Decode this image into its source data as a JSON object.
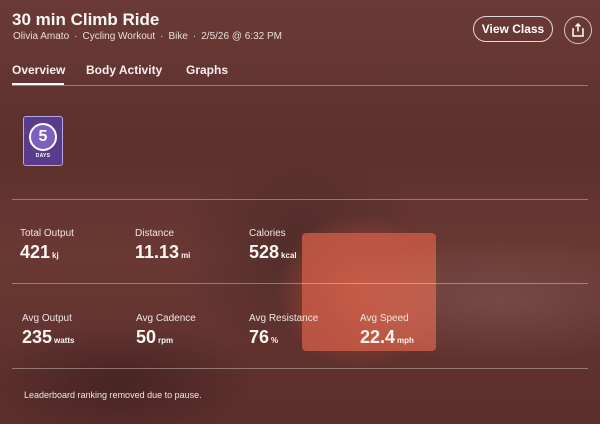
{
  "header": {
    "title": "30 min Climb Ride",
    "instructor": "Olivia Amato",
    "category": "Cycling Workout",
    "device": "Bike",
    "datetime": "2/5/26 @ 6:32 PM",
    "view_class_label": "View Class",
    "share_icon": "share-icon"
  },
  "tabs": [
    {
      "label": "Overview",
      "active": true
    },
    {
      "label": "Body Activity",
      "active": false
    },
    {
      "label": "Graphs",
      "active": false
    }
  ],
  "badge": {
    "number": "5",
    "label": "DAYS",
    "color": "#5a3c8c"
  },
  "stats_row1": [
    {
      "label": "Total Output",
      "value": "421",
      "unit": "kj"
    },
    {
      "label": "Distance",
      "value": "11.13",
      "unit": "mi"
    },
    {
      "label": "Calories",
      "value": "528",
      "unit": "kcal"
    }
  ],
  "stats_row2": [
    {
      "label": "Avg Output",
      "value": "235",
      "unit": "watts"
    },
    {
      "label": "Avg Cadence",
      "value": "50",
      "unit": "rpm"
    },
    {
      "label": "Avg Resistance",
      "value": "76",
      "unit": "%"
    },
    {
      "label": "Avg Speed",
      "value": "22.4",
      "unit": "mph"
    }
  ],
  "notice": "Leaderboard ranking removed due to pause."
}
